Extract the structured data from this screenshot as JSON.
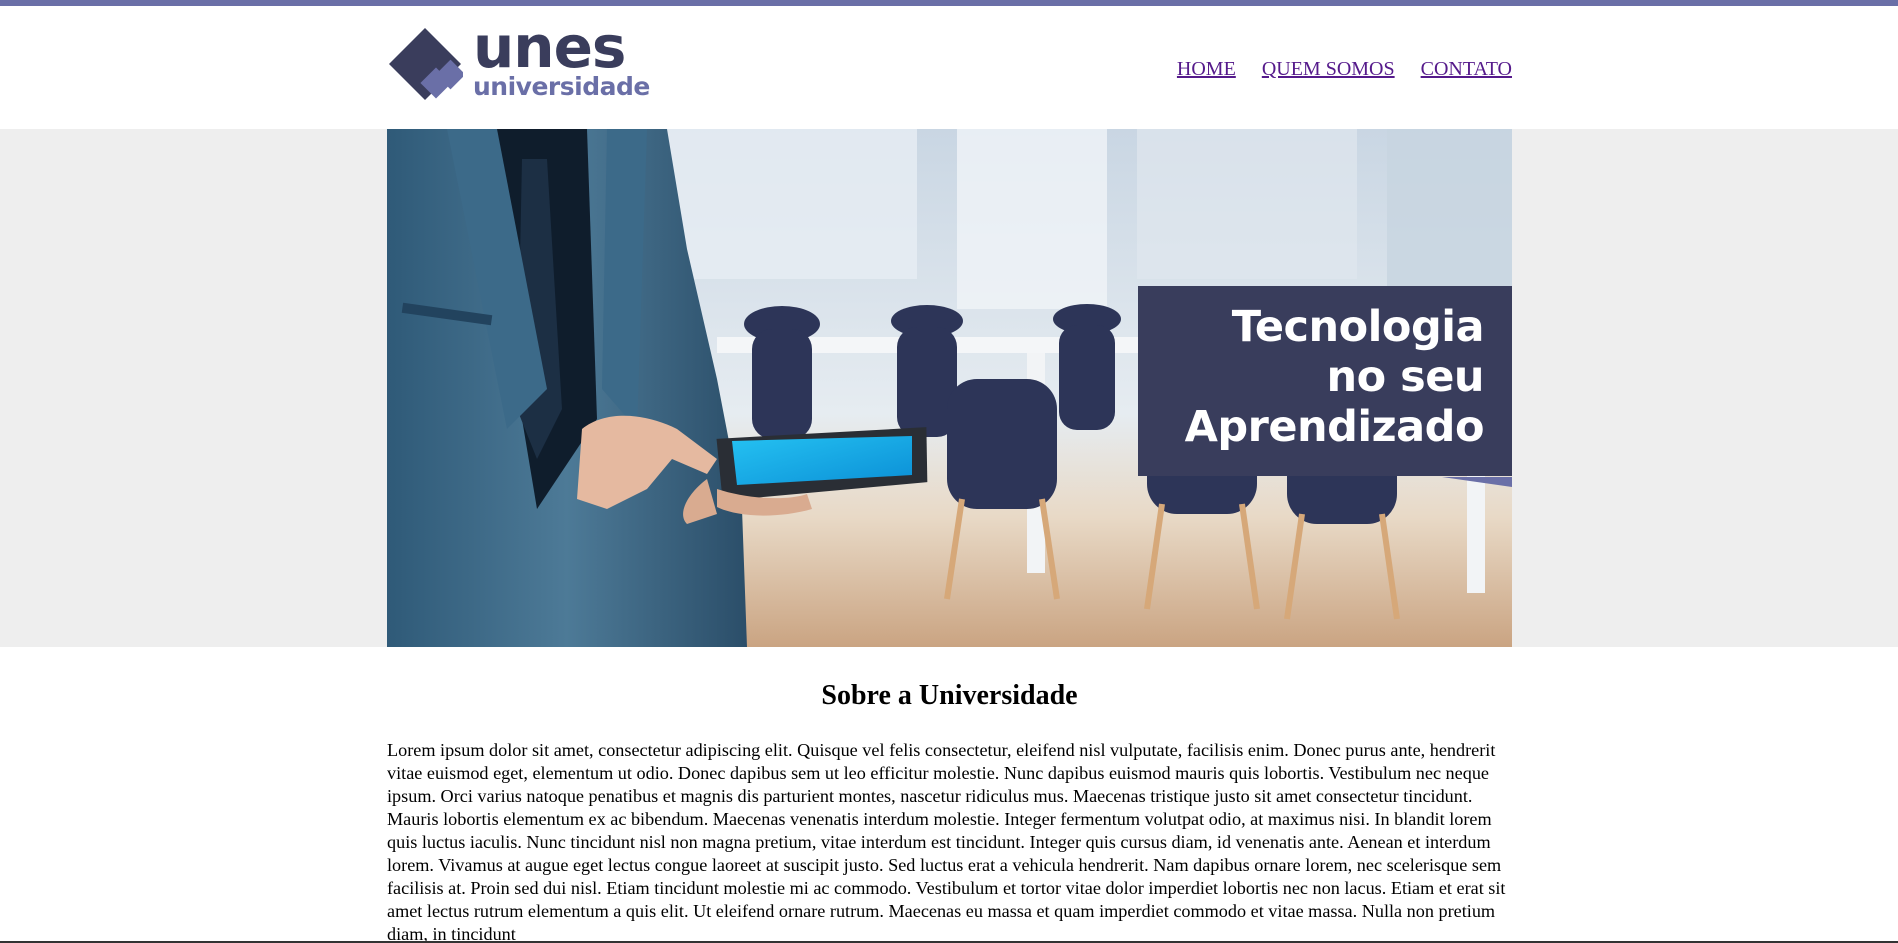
{
  "logo": {
    "main": "unes",
    "sub": "universidade"
  },
  "nav": {
    "items": [
      {
        "label": "HOME"
      },
      {
        "label": "QUEM SOMOS"
      },
      {
        "label": "CONTATO"
      }
    ]
  },
  "hero": {
    "title_lines": [
      "Tecnologia",
      "no seu",
      "Aprendizado"
    ]
  },
  "about": {
    "title": "Sobre a Universidade",
    "body": "Lorem ipsum dolor sit amet, consectetur adipiscing elit. Quisque vel felis consectetur, eleifend nisl vulputate, facilisis enim. Donec purus ante, hendrerit vitae euismod eget, elementum ut odio. Donec dapibus sem ut leo efficitur molestie. Nunc dapibus euismod mauris quis lobortis. Vestibulum nec neque ipsum. Orci varius natoque penatibus et magnis dis parturient montes, nascetur ridiculus mus. Maecenas tristique justo sit amet consectetur tincidunt. Mauris lobortis elementum ex ac bibendum. Maecenas venenatis interdum molestie. Integer fermentum volutpat odio, at maximus nisi. In blandit lorem quis luctus iaculis. Nunc tincidunt nisl non magna pretium, vitae interdum est tincidunt. Integer quis cursus diam, id venenatis ante. Aenean et interdum lorem. Vivamus at augue eget lectus congue laoreet at suscipit justo. Sed luctus erat a vehicula hendrerit. Nam dapibus ornare lorem, nec scelerisque sem facilisis at. Proin sed dui nisl. Etiam tincidunt molestie mi ac commodo. Vestibulum et tortor vitae dolor imperdiet lobortis nec non lacus. Etiam et erat sit amet lectus rutrum elementum a quis elit. Ut eleifend ornare rutrum. Maecenas eu massa et quam imperdiet commodo et vitae massa. Nulla non pretium diam, in tincidunt"
  },
  "colors": {
    "accent": "#6a6fa7",
    "dark": "#393d5c",
    "link": "#551a8b",
    "band": "#eeeeee"
  }
}
